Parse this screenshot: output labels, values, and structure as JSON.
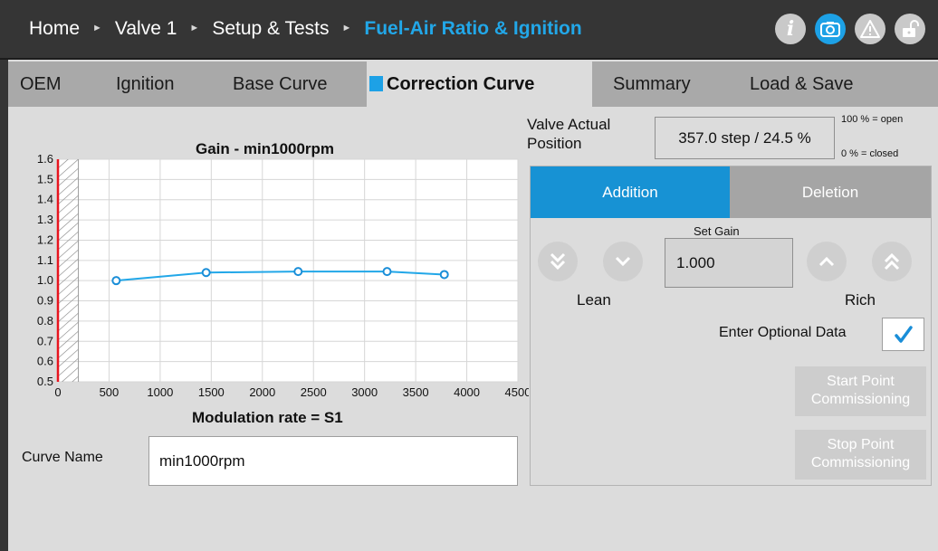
{
  "breadcrumb": [
    "Home",
    "Valve 1",
    "Setup & Tests",
    "Fuel-Air Ratio & Ignition"
  ],
  "header_icons": [
    "info-icon",
    "camera-icon",
    "warning-icon",
    "unlock-icon"
  ],
  "tabs": [
    "OEM",
    "Ignition",
    "Base Curve",
    "Correction Curve",
    "Summary",
    "Load & Save"
  ],
  "active_tab": "Correction Curve",
  "valve": {
    "label": "Valve Actual Position",
    "value": "357.0 step / 24.5 %",
    "open_note": "100 % = open",
    "closed_note": "0 % = closed"
  },
  "panel": {
    "tab_addition": "Addition",
    "tab_deletion": "Deletion",
    "set_gain_label": "Set Gain",
    "set_gain_value": "1.000",
    "lean_label": "Lean",
    "rich_label": "Rich",
    "optional_data_label": "Enter Optional Data",
    "optional_data_checked": true,
    "start_button": "Start Point Commissioning",
    "stop_button": "Stop Point Commissioning"
  },
  "curve_name": {
    "label": "Curve Name",
    "value": "min1000rpm"
  },
  "colors": {
    "accent": "#1da1e6",
    "header_bg": "#353535",
    "line": "#22a7e8",
    "limit_line": "#e8141e"
  },
  "chart_data": {
    "type": "line",
    "title": "Gain - min1000rpm",
    "xlabel": "Modulation rate = S1",
    "ylabel": "",
    "xlim": [
      0,
      4500
    ],
    "ylim": [
      0.5,
      1.6
    ],
    "x_ticks": [
      "0",
      "500",
      "1000",
      "1500",
      "2000",
      "2500",
      "3000",
      "3500",
      "4000",
      "4500"
    ],
    "y_ticks": [
      "0.5",
      "0.6",
      "0.7",
      "0.8",
      "0.9",
      "1.0",
      "1.1",
      "1.2",
      "1.3",
      "1.4",
      "1.5",
      "1.6"
    ],
    "grid": true,
    "series": [
      {
        "x": [
          570,
          1450,
          2350,
          3220,
          3780
        ],
        "values": [
          1.0,
          1.04,
          1.045,
          1.045,
          1.03
        ]
      }
    ]
  }
}
